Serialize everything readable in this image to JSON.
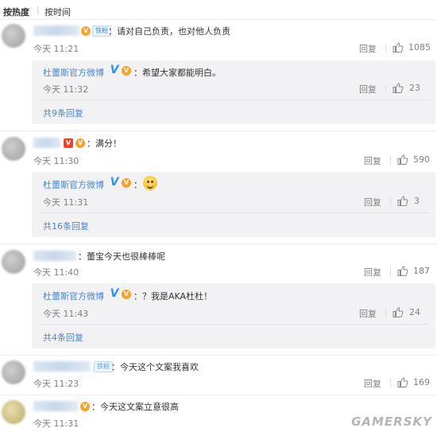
{
  "sort": {
    "hot": "按热度",
    "time": "按时间"
  },
  "comments": [
    {
      "badge": "V",
      "fan_badge": "铁粉",
      "text": "：请对自己负责，也对他人负责",
      "time": "今天 11:21",
      "reply": "回复",
      "likes": "1085",
      "sub": {
        "user": "杜蕾斯官方微博",
        "text": "：希望大家都能明白。",
        "time": "今天 11:32",
        "reply": "回复",
        "likes": "23"
      },
      "more": "共9条回复"
    },
    {
      "badge": "V",
      "text": "：满分！",
      "time": "今天 11:30",
      "reply": "回复",
      "likes": "590",
      "sub": {
        "user": "杜蕾斯官方微博",
        "text": "：",
        "time": "今天 11:31",
        "reply": "回复",
        "likes": "3"
      },
      "more": "共16条回复"
    },
    {
      "text": "：蕾宝今天也很棒棒呢",
      "time": "今天 11:40",
      "reply": "回复",
      "likes": "187",
      "sub": {
        "user": "杜蕾斯官方微博",
        "text": "：？我是AKA杜杜！",
        "time": "今天 11:43",
        "reply": "回复",
        "likes": "24"
      },
      "more": "共4条回复"
    },
    {
      "fan_badge": "铁粉",
      "text": "：今天这个文案我喜欢",
      "time": "今天 11:23",
      "reply": "回复",
      "likes": "169"
    },
    {
      "text": "：今天这文案立意很高",
      "time": "今天 11:31"
    }
  ],
  "watermark": "GAMERSKY",
  "colors": {
    "link": "#4b86c9",
    "reply_bg": "#f2f2f5",
    "muted": "#808080"
  },
  "icons": {
    "like": "thumbs-up-icon",
    "verified": "verified-v-icon",
    "emoji": "smile-emoji-icon"
  }
}
